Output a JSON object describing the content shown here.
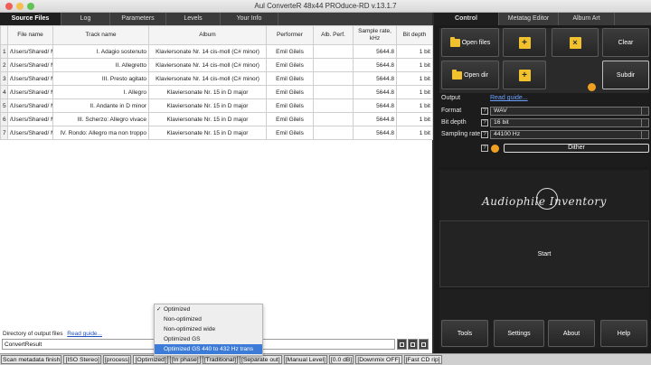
{
  "window": {
    "title": "Aul ConverteR 48x44 PROduce-RD v.13.1.7"
  },
  "left_tabs": [
    "Source Files",
    "Log",
    "Parameters",
    "Levels",
    "Your Info"
  ],
  "table": {
    "headers": [
      "",
      "File name",
      "Track name",
      "Album",
      "Performer",
      "Alb. Perf.",
      "Sample rate, kHz",
      "Bit depth"
    ],
    "rows": [
      [
        "1",
        "/Users/Shared/ Music/Piano ...",
        "I. Adagio sostenuto",
        "Klaviersonate Nr. 14 cis-moll (C# minor)",
        "Emil Gilels",
        "",
        "5644.8",
        "1 bit"
      ],
      [
        "2",
        "/Users/Shared/ Music/Piano ...",
        "II. Allegretto",
        "Klaviersonate Nr. 14 cis-moll (C# minor)",
        "Emil Gilels",
        "",
        "5644.8",
        "1 bit"
      ],
      [
        "3",
        "/Users/Shared/ Music/Piano ...",
        "III. Presto agitato",
        "Klaviersonate Nr. 14 cis-moll (C# minor)",
        "Emil Gilels",
        "",
        "5644.8",
        "1 bit"
      ],
      [
        "4",
        "/Users/Shared/ Music/Piano ...",
        "I. Allegro",
        "Klaviersonate Nr. 15 in D major",
        "Emil Gilels",
        "",
        "5644.8",
        "1 bit"
      ],
      [
        "5",
        "/Users/Shared/ Music/Piano ...",
        "II. Andante in D minor",
        "Klaviersonate Nr. 15 in D major",
        "Emil Gilels",
        "",
        "5644.8",
        "1 bit"
      ],
      [
        "6",
        "/Users/Shared/ Music/Piano ...",
        "III. Scherzo: Allegro vivace",
        "Klaviersonate Nr. 15 in D major",
        "Emil Gilels",
        "",
        "5644.8",
        "1 bit"
      ],
      [
        "7",
        "/Users/Shared/ Music/Piano ...",
        "IV. Rondo: Allegro ma non troppo",
        "Klaviersonate Nr. 15 in D major",
        "Emil Gilels",
        "",
        "5644.8",
        "1 bit"
      ]
    ]
  },
  "output_dir": {
    "label": "Directory of output files",
    "link": "Read guide...",
    "value": "ConvertResult"
  },
  "dropdown": {
    "options": [
      "Optimized",
      "Non-optimized",
      "Non-optimized wide",
      "Optimized GS",
      "Optimized GS 440 to 432 Hz trans"
    ],
    "checked": "Optimized",
    "highlighted": "Optimized GS 440 to 432 Hz trans"
  },
  "status_bar": [
    "Scan metadata finish",
    "[ISO Stereo]",
    "[process]",
    "[Optimized]",
    "[In phase]",
    "[Traditional]",
    "[Separate out]",
    "[Manual Level]",
    "[0.0 dB]",
    "[Downmix OFF]",
    "[Fast CD rip]"
  ],
  "right_tabs": [
    "Control",
    "Metatag Editor",
    "Album Art"
  ],
  "controls": {
    "open_files": "Open files",
    "clear": "Clear",
    "open_dir": "Open dir",
    "subdir": "Subdir"
  },
  "output": {
    "label": "Output",
    "link": "Read guide...",
    "format_label": "Format",
    "format_value": "WAV",
    "bitdepth_label": "Bit depth",
    "bitdepth_value": "16 bit",
    "samplerate_label": "Sampling rate",
    "samplerate_value": "44100 Hz",
    "q": "?",
    "dither": "Dither"
  },
  "logo": {
    "text": "Audiophile  Inventory"
  },
  "start": "Start",
  "bottom_buttons": [
    "Tools",
    "Settings",
    "About",
    "Help"
  ],
  "colors": {
    "accent": "#f2c12e",
    "selection": "#3d7bd9"
  }
}
